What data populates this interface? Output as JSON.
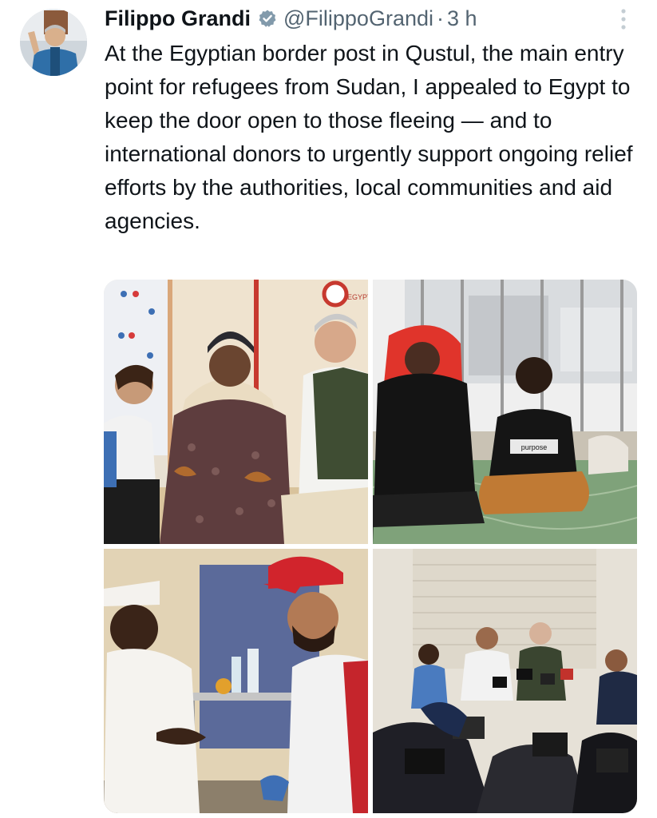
{
  "tweet": {
    "author_name": "Filippo Grandi",
    "handle": "@FilippoGrandi",
    "separator": "·",
    "time": "3 h",
    "verified": true,
    "text": "At the Egyptian border post in Qustul, the main entry point for refugees from Sudan, I appealed to Egypt to keep the door open to those fleeing — and to international donors to urgently support ongoing relief efforts by the authorities, local communities and aid agencies."
  },
  "media": {
    "photo_count": 4,
    "photo1_tent_text": "EGYPT",
    "photo2_tshirt_text": "purpose"
  },
  "colors": {
    "text": "#0f1419",
    "secondary": "#536471",
    "verified_badge": "#829aab",
    "background": "#ffffff"
  },
  "icons": [
    "verified-badge-icon",
    "more-options-icon"
  ]
}
